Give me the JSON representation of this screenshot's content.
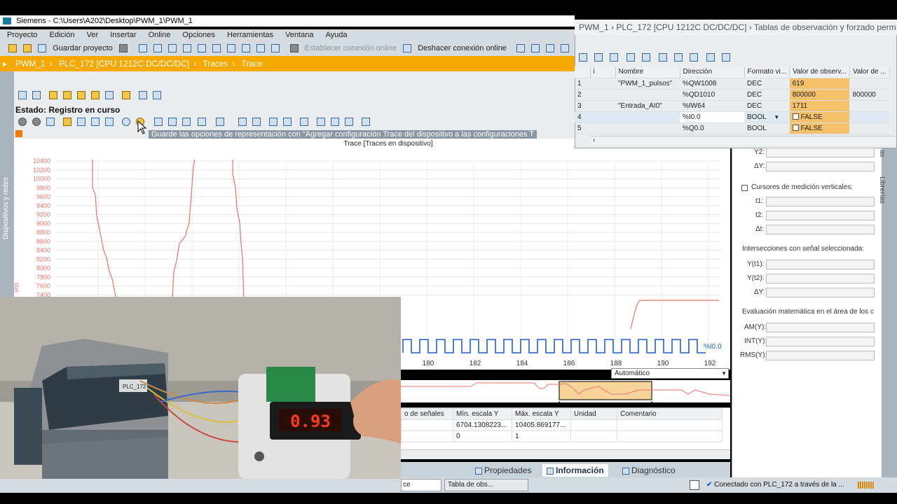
{
  "window": {
    "title": "Siemens  -  C:\\Users\\A202\\Desktop\\PWM_1\\PWM_1"
  },
  "menu": [
    "Proyecto",
    "Edición",
    "Ver",
    "Insertar",
    "Online",
    "Opciones",
    "Herramientas",
    "Ventana",
    "Ayuda"
  ],
  "toolbar": {
    "save": "Guardar proyecto",
    "connect": "Establecer conexión online",
    "disconnect": "Deshacer conexión online"
  },
  "breadcrumb": [
    "PWM_1",
    "PLC_172 [CPU 1212C DC/DC/DC]",
    "Traces",
    "Trace"
  ],
  "left_strip": "Dispositivos y redes",
  "trace": {
    "status": "Estado: Registro en curso",
    "hint": "Guarde las opciones de representación con \"Agregar configuración Trace del dispositivo a las configuraciones T",
    "chart_title": "Trace [Traces en dispositivo]",
    "y_unit": "sos",
    "signal_label": "%I0.0",
    "view_select": "Automático",
    "signal_table": {
      "headers": [
        "o de señales",
        "Mín. escala Y",
        "Máx. escala Y",
        "Unidad",
        "Comentario"
      ],
      "rows": [
        [
          "",
          "6704.1308223...",
          "10405.869177...",
          "",
          ""
        ],
        [
          "",
          "0",
          "1",
          "",
          ""
        ]
      ]
    }
  },
  "chart_data": {
    "type": "line",
    "title": "Trace [Traces en dispositivo]",
    "y_ticks": [
      10400,
      10200,
      10000,
      9800,
      9600,
      9400,
      9200,
      9000,
      8800,
      8600,
      8400,
      8200,
      8000,
      7800,
      7600,
      7400
    ],
    "x_ticks": [
      180,
      182,
      184,
      186,
      188,
      190,
      192
    ],
    "series": [
      {
        "name": "\"Entrada_AI0\""
      },
      {
        "name": "%I0.0"
      }
    ]
  },
  "bottom_tabs": {
    "propiedades": "Propiedades",
    "informacion": "Información",
    "diagnostico": "Diagnóstico"
  },
  "taskbar": {
    "task1": "ce",
    "task2": "Tabla de obs...",
    "status": "Conectado con PLC_172 a través de la ..."
  },
  "watch": {
    "header": "PWM_1  ›  PLC_172 [CPU 1212C DC/DC/DC]  ›  Tablas de observación y forzado perm",
    "columns": [
      "",
      "i",
      "Nombre",
      "Dirección",
      "Formato vi...",
      "Valor de observ...",
      "Valor de ..."
    ],
    "rows": [
      {
        "n": "1",
        "name": "\"PWM_1_pulsos\"",
        "addr": "%QW1008",
        "fmt": "DEC",
        "val": "619",
        "mod": ""
      },
      {
        "n": "2",
        "name": "",
        "addr": "%QD1010",
        "fmt": "DEC",
        "val": "800000",
        "mod": "800000"
      },
      {
        "n": "3",
        "name": "\"Entrada_AI0\"",
        "addr": "%IW64",
        "fmt": "DEC",
        "val": "1711",
        "mod": ""
      },
      {
        "n": "4",
        "name": "",
        "addr": "%I0.0",
        "fmt": "BOOL",
        "val": "FALSE",
        "mod": ""
      },
      {
        "n": "5",
        "name": "",
        "addr": "%Q0.0",
        "fmt": "BOOL",
        "val": "FALSE",
        "mod": ""
      }
    ]
  },
  "measure": {
    "y2": "Y2:",
    "dy": "ΔY:",
    "vertical": "Cursores de medición verticales:",
    "t1": "t1:",
    "t2": "t2:",
    "dt": "Δt:",
    "intersections": "Intersecciones con señal seleccionada:",
    "yt1": "Y(t1):",
    "yt2": "Y(t2):",
    "dy2": "ΔY:",
    "math": "Evaluación matemática en el área de los c",
    "am": "AM(Y):",
    "int": "INT(Y):",
    "rms": "RMS(Y):"
  },
  "right_strip": "Librerías",
  "right_strip2": "as",
  "photo": {
    "display": "0.93",
    "plc_label": "PLC_172"
  },
  "colors": {
    "accent": "#f5a800",
    "trace_red": "#e8736b",
    "trace_blue": "#1f5fd6"
  }
}
